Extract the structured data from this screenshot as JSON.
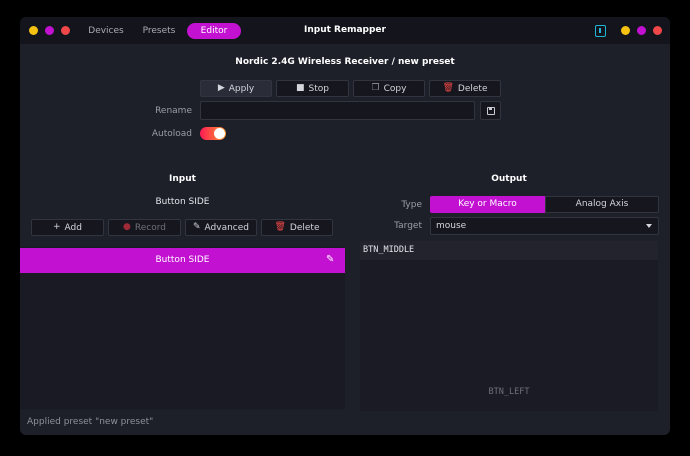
{
  "window": {
    "title": "Input Remapper",
    "tabs": [
      {
        "label": "Devices"
      },
      {
        "label": "Presets"
      },
      {
        "label": "Editor"
      }
    ],
    "dot_colors_left": [
      "#f5c211",
      "#c211d0",
      "#f04848"
    ],
    "dot_colors_right": [
      "#f5c211",
      "#c211d0",
      "#f04848"
    ]
  },
  "device_title": "Nordic 2.4G Wireless Receiver  /  new preset",
  "preset_toolbar": {
    "apply": "Apply",
    "stop": "Stop",
    "copy": "Copy",
    "delete": "Delete"
  },
  "rename": {
    "label": "Rename",
    "value": ""
  },
  "autoload": {
    "label": "Autoload",
    "enabled": true
  },
  "input": {
    "heading": "Input",
    "selected_label": "Button SIDE",
    "toolbar": {
      "add": "Add",
      "record": "Record",
      "advanced": "Advanced",
      "delete": "Delete"
    },
    "rows": [
      {
        "label": "Button SIDE",
        "selected": true
      }
    ]
  },
  "output": {
    "heading": "Output",
    "type_label": "Type",
    "type_options": [
      "Key or Macro",
      "Analog Axis"
    ],
    "type_selected": "Key or Macro",
    "target_label": "Target",
    "target_value": "mouse",
    "code": "BTN_MIDDLE",
    "hint": "BTN_LEFT"
  },
  "status": "Applied preset \"new preset\"",
  "colors": {
    "accent": "#c211d0",
    "help_icon": "#22b6d6"
  }
}
